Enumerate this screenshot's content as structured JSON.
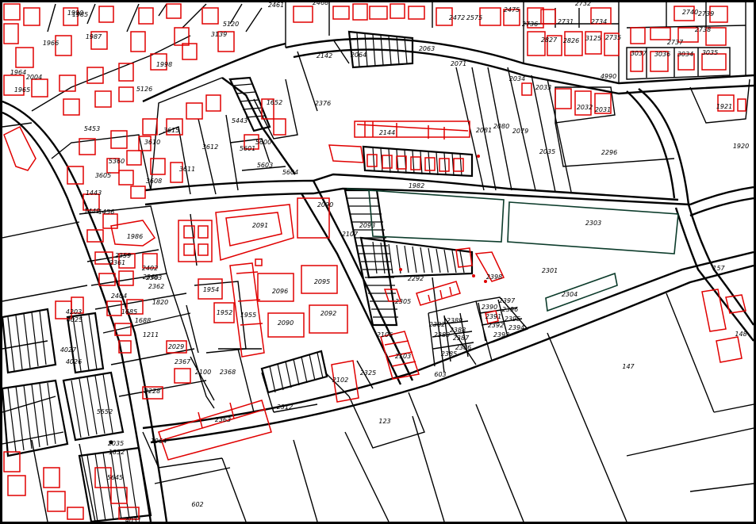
{
  "map": {
    "type": "cadastral-map",
    "colors": {
      "parcel": "#000000",
      "building": "#e00000",
      "special": "#0b3b2a",
      "background": "#ffffff"
    },
    "parcel_labels": [
      "2461",
      "2468",
      "2472",
      "2575",
      "2475",
      "2731",
      "2732",
      "2734",
      "2740",
      "2739",
      "2738",
      "2736",
      "2827",
      "2826",
      "3125",
      "2735",
      "2737",
      "3037",
      "3036",
      "3034",
      "3035",
      "4990",
      "2142",
      "2064",
      "2063",
      "2071",
      "2034",
      "2033",
      "2032",
      "2031",
      "2376",
      "1921",
      "1920",
      "2296",
      "2081",
      "2080",
      "2079",
      "2035",
      "2144",
      "1982",
      "2303",
      "2301",
      "2304",
      "157",
      "148",
      "147",
      "603",
      "123",
      "602",
      "5453",
      "3612",
      "3615",
      "5443",
      "5601",
      "5600",
      "3611",
      "3605",
      "3608",
      "2091",
      "1986",
      "2402",
      "2363",
      "2362",
      "2404",
      "1820",
      "1954",
      "1952",
      "1955",
      "2096",
      "2095",
      "2090",
      "2092",
      "1211",
      "2029",
      "2367",
      "2100",
      "2368",
      "2325",
      "2102",
      "2312",
      "2363",
      "1964",
      "2382",
      "2389",
      "2388",
      "2387",
      "2386",
      "2385",
      "2383",
      "2390",
      "2391",
      "2392",
      "2393",
      "2394",
      "2395",
      "2396",
      "2397",
      "2398",
      "2292",
      "2103",
      "2106",
      "2107",
      "4203",
      "4027",
      "5552",
      "2228",
      "1852",
      "5360",
      "5603",
      "5604",
      "2090",
      "2093",
      "2305",
      "1990",
      "1998",
      "3139",
      "5120",
      "5126",
      "1985",
      "1987",
      "1966",
      "1964",
      "1965",
      "2004",
      "4025",
      "4026",
      "2035",
      "5645",
      "1652",
      "4031",
      "2359",
      "3610",
      "1443",
      "1449",
      "1456",
      "2361",
      "2365",
      "1685",
      "1688"
    ]
  }
}
